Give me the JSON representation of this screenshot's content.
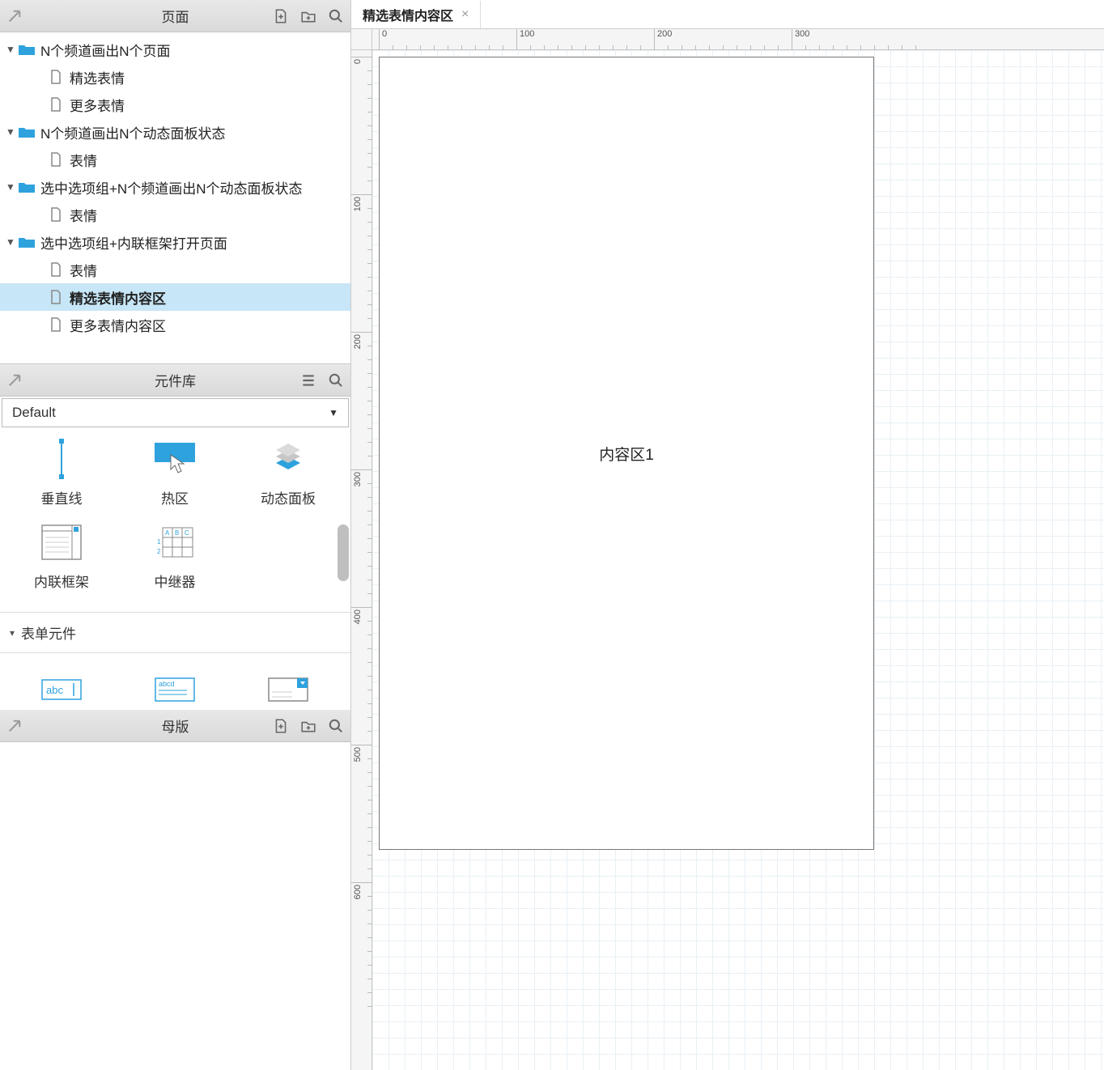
{
  "panels": {
    "pages": {
      "title": "页面",
      "tree": [
        {
          "type": "folder",
          "label": "N个频道画出N个页面",
          "expanded": true,
          "children": [
            {
              "type": "page",
              "label": "精选表情"
            },
            {
              "type": "page",
              "label": "更多表情"
            }
          ]
        },
        {
          "type": "folder",
          "label": "N个频道画出N个动态面板状态",
          "expanded": true,
          "children": [
            {
              "type": "page",
              "label": "表情"
            }
          ]
        },
        {
          "type": "folder",
          "label": "选中选项组+N个频道画出N个动态面板状态",
          "expanded": true,
          "children": [
            {
              "type": "page",
              "label": "表情"
            }
          ]
        },
        {
          "type": "folder",
          "label": "选中选项组+内联框架打开页面",
          "expanded": true,
          "children": [
            {
              "type": "page",
              "label": "表情"
            },
            {
              "type": "page",
              "label": "精选表情内容区",
              "selected": true
            },
            {
              "type": "page",
              "label": "更多表情内容区"
            }
          ]
        }
      ]
    },
    "library": {
      "title": "元件库",
      "selected_library": "Default",
      "widgets_row1": [
        {
          "id": "vertical-line",
          "label": "垂直线"
        },
        {
          "id": "hot-spot",
          "label": "热区"
        },
        {
          "id": "dynamic-panel",
          "label": "动态面板"
        }
      ],
      "widgets_row2": [
        {
          "id": "inline-frame",
          "label": "内联框架"
        },
        {
          "id": "repeater",
          "label": "中继器"
        }
      ],
      "group_header": "表单元件"
    },
    "masters": {
      "title": "母版"
    }
  },
  "canvas": {
    "active_tab": "精选表情内容区",
    "artboard_text": "内容区1",
    "ruler_major_h": [
      0,
      100,
      200,
      300
    ],
    "ruler_major_v": [
      0,
      100,
      200,
      300,
      400,
      500,
      600
    ]
  },
  "colors": {
    "accent": "#2ea2dd",
    "selection": "#c7e6f7"
  }
}
